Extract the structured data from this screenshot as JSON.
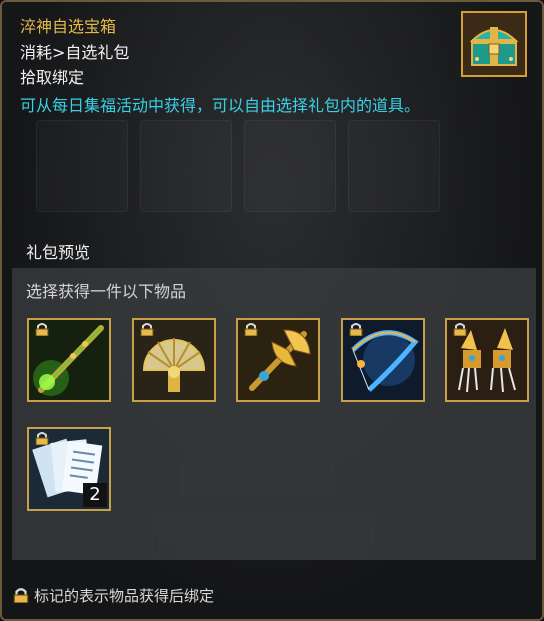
{
  "item": {
    "name": "淬神自选宝箱",
    "category": "消耗>自选礼包",
    "bind": "拾取绑定",
    "description": "可从每日集福活动中获得，可以自由选择礼包内的道具。",
    "icon": "treasure-chest-icon"
  },
  "preview": {
    "title": "礼包预览",
    "subtitle": "选择获得一件以下物品",
    "items": [
      {
        "icon": "green-spear-icon",
        "locked": true,
        "count": ""
      },
      {
        "icon": "golden-fan-icon",
        "locked": true,
        "count": ""
      },
      {
        "icon": "golden-axe-icon",
        "locked": true,
        "count": ""
      },
      {
        "icon": "blue-bow-icon",
        "locked": true,
        "count": ""
      },
      {
        "icon": "golden-claws-icon",
        "locked": true,
        "count": ""
      },
      {
        "icon": "scroll-pages-icon",
        "locked": true,
        "count": "2"
      }
    ]
  },
  "footer": {
    "note": "标记的表示物品获得后绑定",
    "icon": "lock-icon"
  },
  "colors": {
    "title": "#e6b94a",
    "description": "#39d1e8",
    "slot_border": "#c9a04a"
  }
}
